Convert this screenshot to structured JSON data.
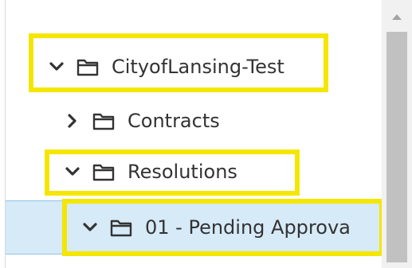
{
  "tree": {
    "items": [
      {
        "label": "CityofLansing-Test",
        "expanded": true,
        "icon": "folder-icon"
      },
      {
        "label": "Contracts",
        "expanded": false,
        "icon": "folder-icon"
      },
      {
        "label": "Resolutions",
        "expanded": true,
        "icon": "folder-icon"
      },
      {
        "label": "01 - Pending Approva",
        "expanded": true,
        "icon": "folder-icon",
        "selected": true
      }
    ]
  },
  "colors": {
    "highlight": "#f5e600",
    "selected_bg": "#d6eaf8",
    "text": "#333333",
    "scroll_thumb": "#c1c1c1"
  }
}
